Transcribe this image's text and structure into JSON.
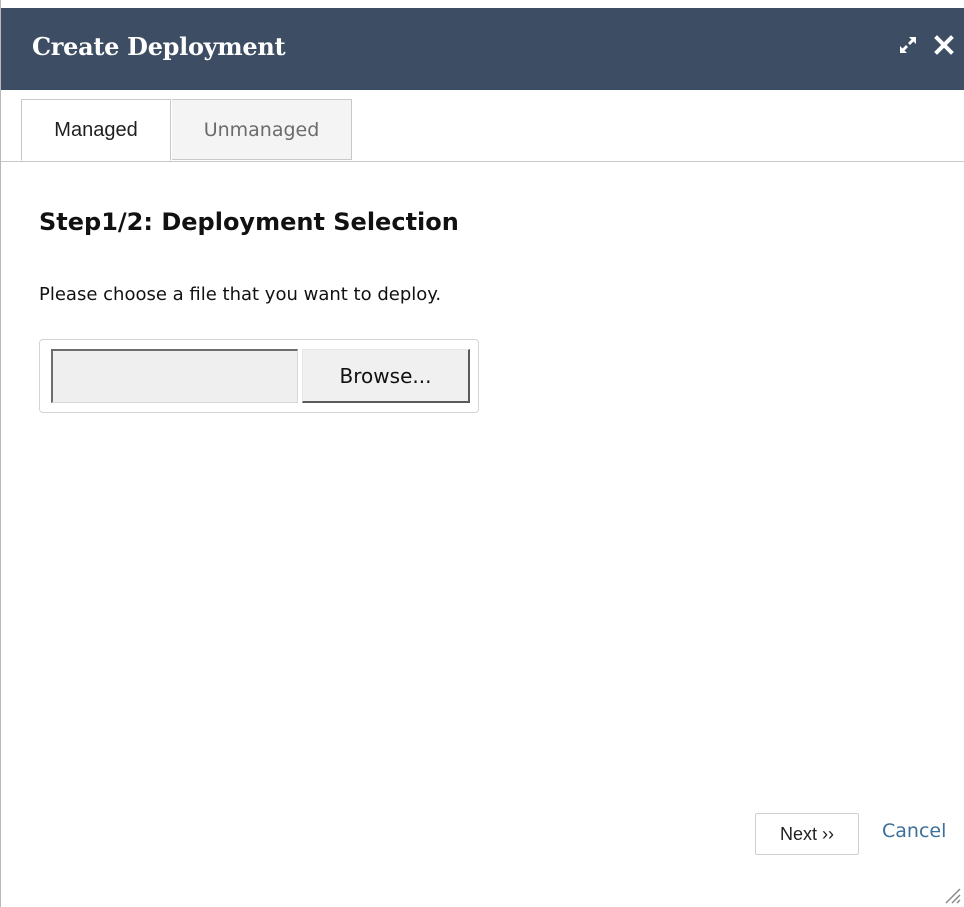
{
  "dialog": {
    "title": "Create Deployment",
    "icons": [
      "expand-icon",
      "close-icon"
    ]
  },
  "tabs": [
    {
      "label": "Managed",
      "active": true
    },
    {
      "label": "Unmanaged",
      "active": false
    }
  ],
  "step": {
    "heading": "Step1/2: Deployment Selection",
    "description": "Please choose a file that you want to deploy."
  },
  "file_picker": {
    "value": "",
    "browse_label": "Browse..."
  },
  "footer": {
    "next_label": "Next ››",
    "cancel_label": "Cancel"
  },
  "colors": {
    "titlebar": "#3d4d63",
    "link": "#3d6f9d"
  }
}
